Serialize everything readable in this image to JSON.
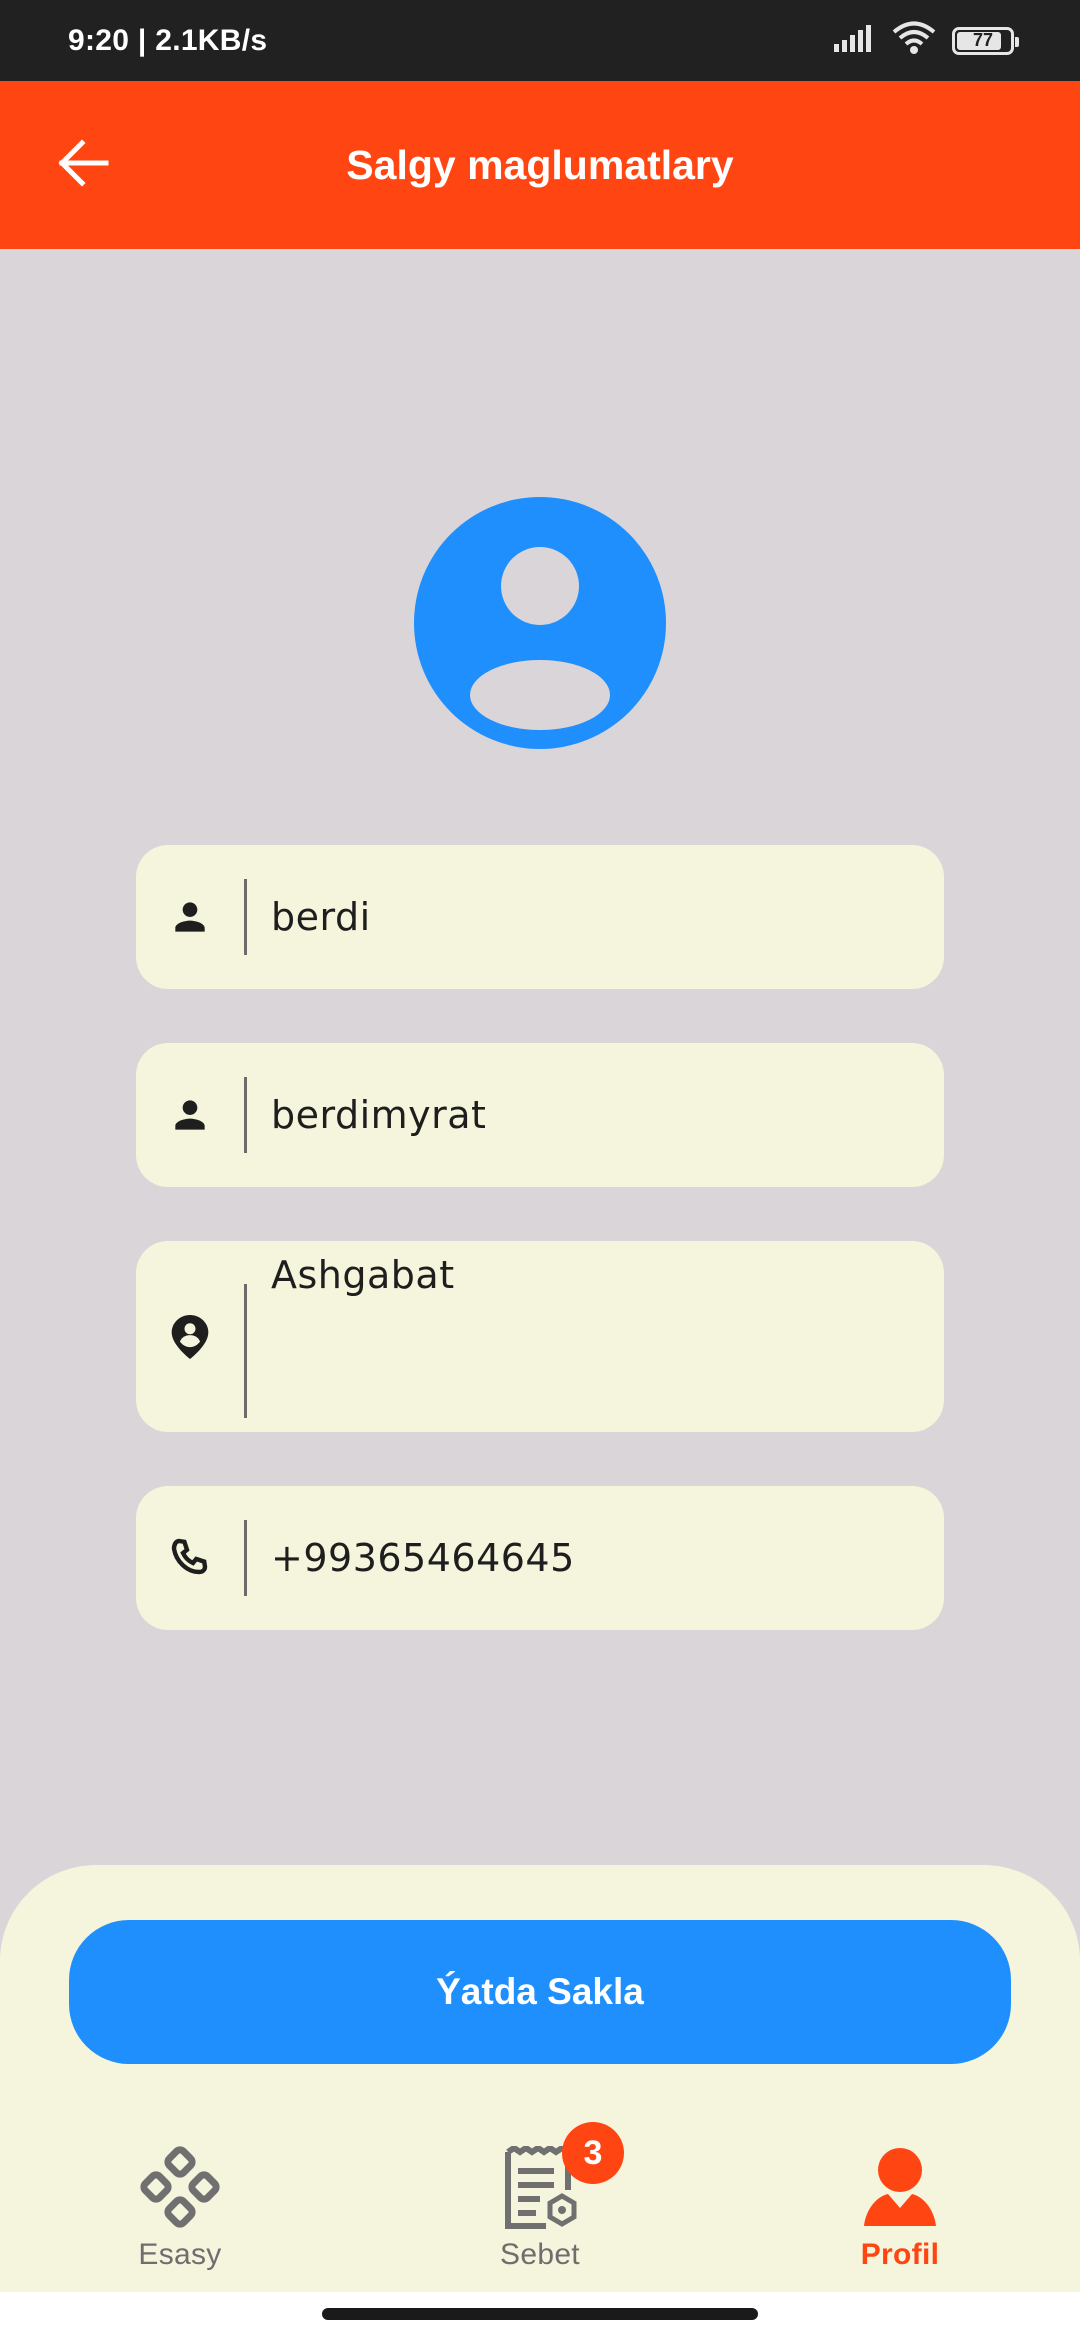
{
  "status_bar": {
    "time_speed": "9:20 | 2.1KB/s",
    "battery": "77"
  },
  "app_bar": {
    "back_icon": "arrow-left-icon",
    "title": "Salgy maglumatlary"
  },
  "avatar": {
    "icon": "account-circle-icon"
  },
  "form": {
    "first_name": {
      "icon": "person-icon",
      "value": "berdi"
    },
    "last_name": {
      "icon": "person-icon",
      "value": "berdimyrat"
    },
    "address": {
      "icon": "location-person-icon",
      "value": "Ashgabat"
    },
    "phone": {
      "icon": "phone-icon",
      "value": "+99365464645"
    }
  },
  "save_button": {
    "label": "Ýatda Sakla"
  },
  "bottom_nav": {
    "items": [
      {
        "label": "Esasy",
        "icon": "home-diamond-icon",
        "active": false
      },
      {
        "label": "Sebet",
        "icon": "receipt-icon",
        "badge": "3",
        "active": false
      },
      {
        "label": "Profil",
        "icon": "profile-icon",
        "active": true
      }
    ]
  },
  "colors": {
    "accent": "#ff4511",
    "primary_blue": "#1f8ffd",
    "background": "#d9d5d8",
    "field_background": "#f5f4dc"
  }
}
